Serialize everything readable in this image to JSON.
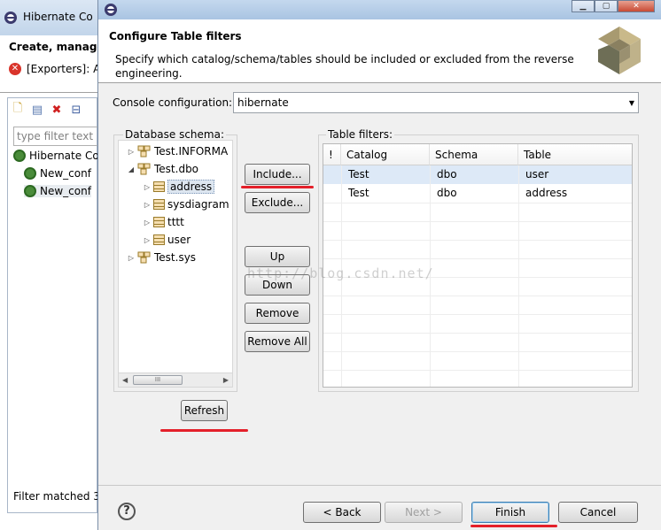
{
  "background_window": {
    "title": "Hibernate Co",
    "banner_title": "Create, manage,",
    "error_text": "[Exporters]: A",
    "filter_placeholder": "type filter text",
    "tree": [
      {
        "label": "Hibernate Co"
      },
      {
        "label": "New_conf"
      },
      {
        "label": "New_conf"
      }
    ],
    "status": "Filter matched 3"
  },
  "dialog": {
    "header_title": "Configure Table filters",
    "header_description": "Specify which catalog/schema/tables should be included or excluded from the reverse engineering.",
    "console_label": "Console configuration:",
    "console_value": "hibernate",
    "schema_group_label": "Database schema:",
    "schema_tree": [
      {
        "label": "Test.INFORMA",
        "expander": "▷",
        "icon": "database-icon"
      },
      {
        "label": "Test.dbo",
        "expander": "◢",
        "icon": "database-icon"
      },
      {
        "label": "address",
        "expander": "▷",
        "icon": "table-icon",
        "selected": true
      },
      {
        "label": "sysdiagram",
        "expander": "▷",
        "icon": "table-icon"
      },
      {
        "label": "tttt",
        "expander": "▷",
        "icon": "table-icon"
      },
      {
        "label": "user",
        "expander": "▷",
        "icon": "table-icon"
      },
      {
        "label": "Test.sys",
        "expander": "▷",
        "icon": "database-icon"
      }
    ],
    "scroll_thumb": "III",
    "buttons": {
      "include": "Include...",
      "exclude": "Exclude...",
      "up": "Up",
      "down": "Down",
      "remove": "Remove",
      "remove_all": "Remove All",
      "refresh": "Refresh",
      "back": "< Back",
      "next": "Next >",
      "finish": "Finish",
      "cancel": "Cancel"
    },
    "filters_group_label": "Table filters:",
    "filters_table": {
      "columns": [
        "!",
        "Catalog",
        "Schema",
        "Table"
      ],
      "rows": [
        {
          "flag": "",
          "catalog": "Test",
          "schema": "dbo",
          "table": "user"
        },
        {
          "flag": "",
          "catalog": "Test",
          "schema": "dbo",
          "table": "address"
        }
      ]
    },
    "watermark": "http://blog.csdn.net/",
    "colors": {
      "annotation_red": "#e4202a",
      "selection": "#dde9f7"
    }
  }
}
